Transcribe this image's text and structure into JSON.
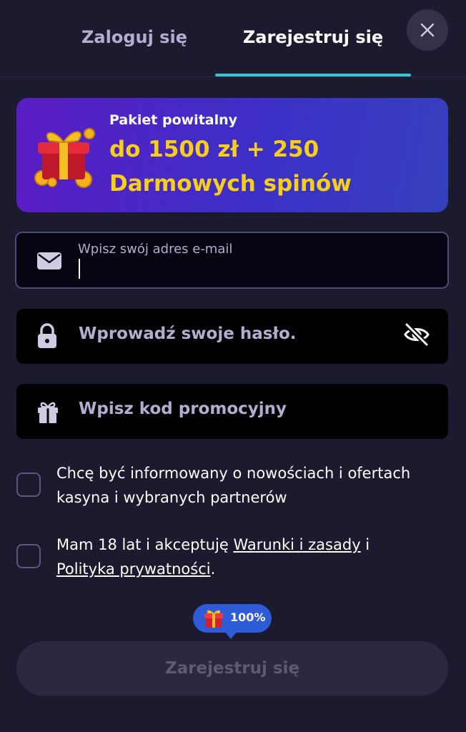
{
  "tabs": {
    "login_label": "Zaloguj się",
    "register_label": "Zarejestruj się",
    "active": "register"
  },
  "close_icon": "close-icon",
  "banner": {
    "subtitle": "Pakiet powitalny",
    "line1": "do 1500 zł + 250",
    "line2": "Darmowych spinów",
    "icon": "gift-icon"
  },
  "form": {
    "email": {
      "label": "Wpisz swój adres e-mail",
      "value": "",
      "icon": "envelope-icon"
    },
    "password": {
      "placeholder": "Wprowadź swoje hasło.",
      "icon": "lock-icon",
      "toggle_icon": "eye-slash-icon"
    },
    "promo": {
      "placeholder": "Wpisz kod promocyjny",
      "icon": "gift-icon"
    }
  },
  "consents": {
    "marketing_text": "Chcę być informowany o nowościach i ofertach kasyna i wybranych partnerów",
    "terms_prefix": "Mam 18 lat i akceptuję ",
    "terms_link": "Warunki i zasady",
    "terms_middle": " i ",
    "privacy_link": "Polityka prywatności",
    "terms_suffix": "."
  },
  "bonus_badge": {
    "text": "100%",
    "icon": "gift-icon"
  },
  "submit": {
    "label": "Zarejestruj się"
  },
  "colors": {
    "background": "#1b1a2e",
    "accent_underline": "#2fc9dc",
    "banner_highlight": "#f7cf1b",
    "badge": "#2e5bd6"
  }
}
